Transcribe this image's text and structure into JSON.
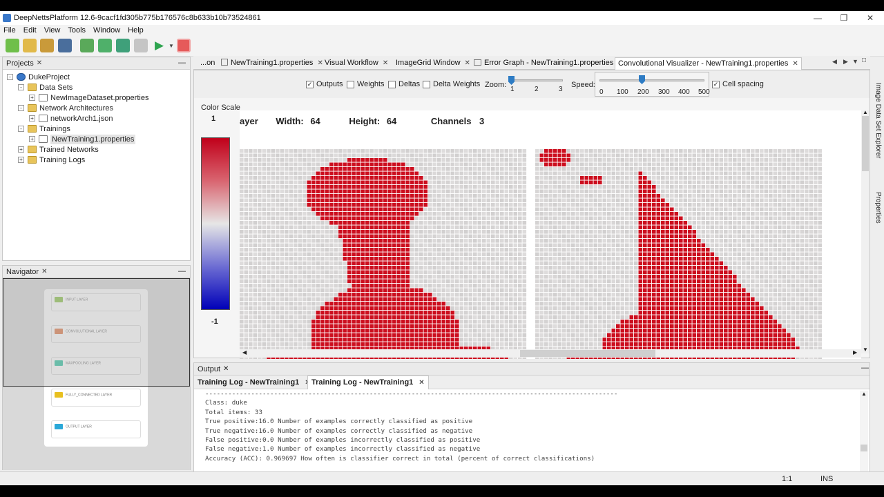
{
  "window": {
    "title": "DeepNettsPlatform 12.6-9cacf1fd305b775b176576c8b633b10b73524861"
  },
  "menu": [
    "File",
    "Edit",
    "View",
    "Tools",
    "Window",
    "Help"
  ],
  "projects": {
    "tab_label": "Projects",
    "tree": [
      {
        "label": "DukeProject",
        "level": 0,
        "icon": "project-icon",
        "toggle": "-"
      },
      {
        "label": "Data Sets",
        "level": 1,
        "icon": "folder-icon",
        "toggle": "-"
      },
      {
        "label": "NewImageDataset.properties",
        "level": 2,
        "icon": "dataset-file-icon",
        "toggle": "+"
      },
      {
        "label": "Network Architectures",
        "level": 1,
        "icon": "folder-icon",
        "toggle": "-"
      },
      {
        "label": "networkArch1.json",
        "level": 2,
        "icon": "json-file-icon",
        "toggle": "+"
      },
      {
        "label": "Trainings",
        "level": 1,
        "icon": "folder-icon",
        "toggle": "-"
      },
      {
        "label": "NewTraining1.properties",
        "level": 2,
        "icon": "training-file-icon",
        "toggle": "+",
        "selected": true
      },
      {
        "label": "Trained Networks",
        "level": 1,
        "icon": "folder-icon",
        "toggle": "+"
      },
      {
        "label": "Training Logs",
        "level": 1,
        "icon": "folder-icon",
        "toggle": "+"
      }
    ]
  },
  "navigator": {
    "tab_label": "Navigator",
    "layers": [
      {
        "label": "INPUT LAYER",
        "color": "#8bc34a"
      },
      {
        "label": "CONVOLUTIONAL LAYER",
        "color": "#e07a4a"
      },
      {
        "label": "MAXPOOLING LAYER",
        "color": "#2ec4a0"
      },
      {
        "label": "FULLY_CONNECTED LAYER",
        "color": "#e8c020"
      },
      {
        "label": "OUTPUT LAYER",
        "color": "#2aa8d8"
      }
    ]
  },
  "editor_tabs": [
    {
      "label": "...on",
      "closable": false
    },
    {
      "label": "NewTraining1.properties",
      "closable": true
    },
    {
      "label": "Visual Workflow",
      "closable": true
    },
    {
      "label": "ImageGrid Window",
      "closable": true
    },
    {
      "label": "Error Graph - NewTraining1.properties",
      "closable": true
    },
    {
      "label": "Convolutional Visualizer - NewTraining1.properties",
      "closable": true,
      "active": true
    }
  ],
  "visualizer": {
    "checkboxes": [
      {
        "label": "Outputs",
        "checked": true
      },
      {
        "label": "Weights",
        "checked": false
      },
      {
        "label": "Deltas",
        "checked": false
      },
      {
        "label": "Delta Weights",
        "checked": false
      }
    ],
    "zoom": {
      "label": "Zoom:",
      "ticks": [
        "1",
        "2",
        "3"
      ],
      "value": "1"
    },
    "speed": {
      "label": "Speed:",
      "ticks": [
        "0",
        "100",
        "200",
        "300",
        "400",
        "500"
      ],
      "value": "200"
    },
    "cell_spacing": {
      "label": "Cell spacing",
      "checked": true
    },
    "color_scale": {
      "title": "Color Scale",
      "max": "1",
      "min": "-1"
    },
    "layer_info": {
      "layer_label": "ayer",
      "width_label": "Width:",
      "width": "64",
      "height_label": "Height:",
      "height": "64",
      "channels_label": "Channels",
      "channels": "3"
    }
  },
  "output": {
    "title": "Output",
    "tabs": [
      {
        "label": "Training Log - NewTraining1",
        "active": false
      },
      {
        "label": "Training Log - NewTraining1",
        "active": true
      }
    ],
    "log_lines": [
      "------------------------------------------------------------------------------------------------------------",
      "Class: duke",
      "Total items: 33",
      "True positive:16.0 Number of examples correctly classified as positive",
      "True negative:16.0 Number of examples correctly classified as negative",
      "False positive:0.0 Number of examples incorrectly classified as positive",
      "False negative:1.0 Number of examples incorrectly classified as negative",
      "Accuracy (ACC): 0.969697 How often is classifier correct in total (percent of correct classifications)"
    ]
  },
  "status": {
    "position": "1:1",
    "mode": "INS"
  },
  "right_sidebar": [
    "Image Data Set Explorer",
    "Properties"
  ]
}
